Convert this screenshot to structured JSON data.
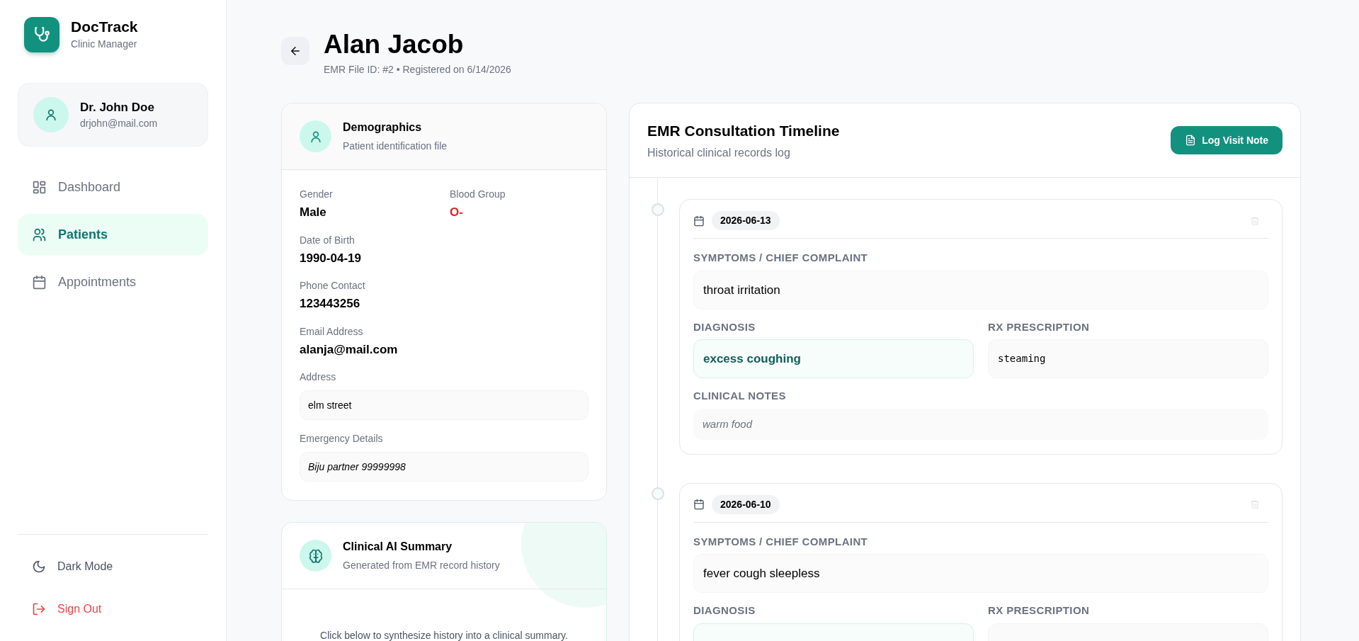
{
  "sidebar": {
    "brand": {
      "name": "DocTrack",
      "subtitle": "Clinic Manager"
    },
    "user": {
      "name": "Dr. John Doe",
      "email": "drjohn@mail.com"
    },
    "nav": [
      {
        "label": "Dashboard",
        "kind": "grid",
        "selected": false
      },
      {
        "label": "Patients",
        "kind": "users",
        "selected": true
      },
      {
        "label": "Appointments",
        "kind": "calendar",
        "selected": false
      }
    ],
    "footer": [
      {
        "label": "Dark Mode",
        "kind": "theme"
      },
      {
        "label": "Sign Out",
        "kind": "signout"
      }
    ]
  },
  "header": {
    "title": "Alan Jacob",
    "subtitle": "EMR File ID: #2 • Registered on 6/14/2026"
  },
  "demographics": {
    "title": "Demographics",
    "subtitle": "Patient identification file",
    "pair": [
      {
        "label": "Gender",
        "value": "Male",
        "kind": "text"
      },
      {
        "label": "Blood Group",
        "value": "O-",
        "kind": "alert"
      }
    ],
    "fields": [
      {
        "label": "Date of Birth",
        "value": "1990-04-19",
        "kind": "text"
      },
      {
        "label": "Phone Contact",
        "value": "123443256",
        "kind": "text"
      },
      {
        "label": "Email Address",
        "value": "alanja@mail.com",
        "kind": "text"
      },
      {
        "label": "Address",
        "value": "elm street",
        "kind": "box"
      },
      {
        "label": "Emergency Details",
        "value": "Biju partner 99999998",
        "kind": "note"
      }
    ]
  },
  "ai_summary": {
    "title": "Clinical AI Summary",
    "subtitle": "Generated from EMR record history",
    "prompt": "Click below to synthesize history into a clinical summary."
  },
  "timeline": {
    "title": "EMR Consultation Timeline",
    "subtitle": "Historical clinical records log",
    "button": "Log Visit Note",
    "entries": [
      {
        "date": "2026-06-13",
        "symptoms": {
          "label": "SYMPTOMS / CHIEF COMPLAINT",
          "value": "throat irritation"
        },
        "diagnosis": {
          "label": "DIAGNOSIS",
          "value": "excess coughing"
        },
        "prescription": {
          "label": "RX PRESCRIPTION",
          "value": "steaming"
        },
        "notes": {
          "label": "CLINICAL NOTES",
          "value": "warm food"
        }
      },
      {
        "date": "2026-06-10",
        "symptoms": {
          "label": "SYMPTOMS / CHIEF COMPLAINT",
          "value": "fever cough sleepless"
        },
        "diagnosis": {
          "label": "DIAGNOSIS"
        },
        "prescription": {
          "label": "RX PRESCRIPTION"
        }
      }
    ]
  }
}
